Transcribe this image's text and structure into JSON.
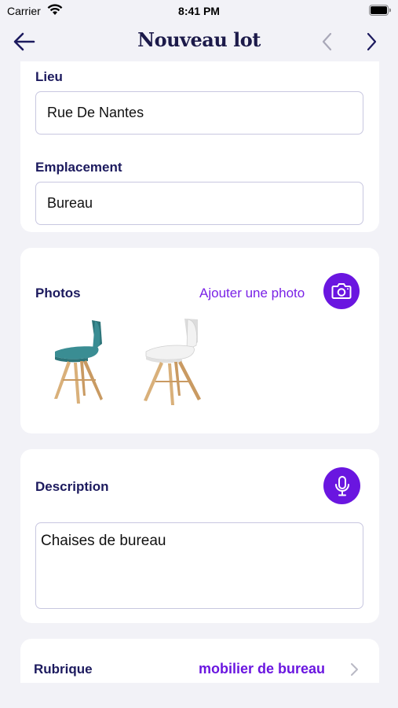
{
  "status_bar": {
    "carrier": "Carrier",
    "time": "8:41 PM"
  },
  "nav": {
    "title": "Nouveau lot"
  },
  "location_card": {
    "lieu_label": "Lieu",
    "lieu_value": "Rue De Nantes",
    "emplacement_label": "Emplacement",
    "emplacement_value": "Bureau"
  },
  "photos_card": {
    "label": "Photos",
    "add_photo": "Ajouter une photo",
    "photos": [
      {
        "icon": "teal-chair-photo",
        "seat_color": "#3a8d93"
      },
      {
        "icon": "white-chair-photo",
        "seat_color": "#f2f2f2"
      }
    ]
  },
  "description_card": {
    "label": "Description",
    "value": "Chaises de bureau"
  },
  "rubrique_card": {
    "label": "Rubrique",
    "value": "mobilier de bureau"
  },
  "colors": {
    "accent": "#6a16e0",
    "label": "#1c1a5e",
    "background": "#f2f2f7"
  }
}
